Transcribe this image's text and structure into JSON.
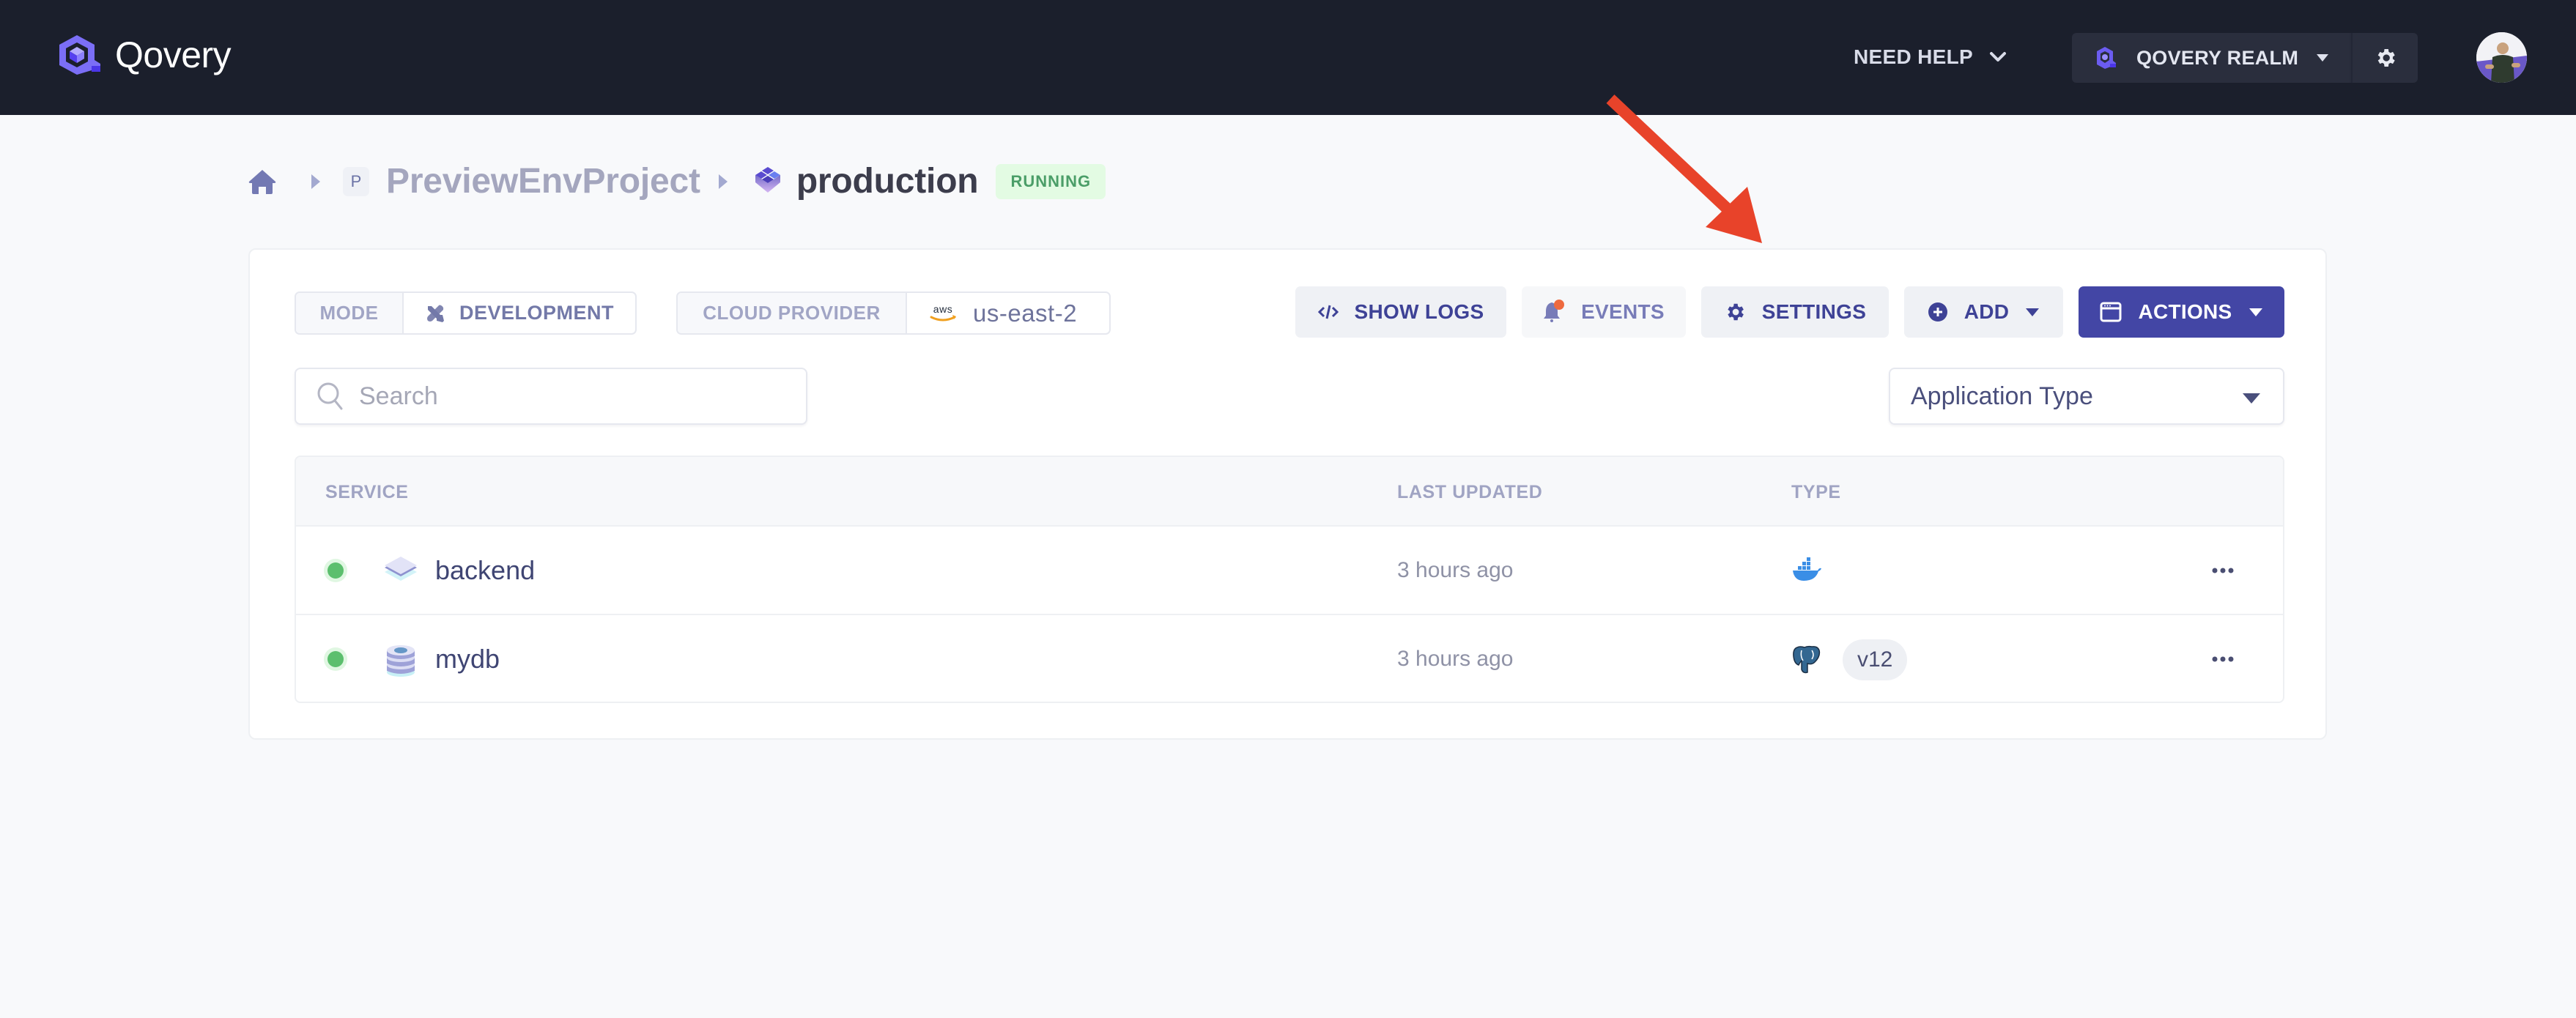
{
  "topbar": {
    "brand": "Qovery",
    "help_label": "NEED HELP",
    "org_label": "QOVERY REALM",
    "colors": {
      "background": "#1b1f2c",
      "brand": "#6f5cf6"
    }
  },
  "annotation": {
    "type": "arrow",
    "color": "#e8432a",
    "points_to": "settings-button"
  },
  "breadcrumb": {
    "project_initial": "P",
    "project": "PreviewEnvProject",
    "environment": "production",
    "status": "RUNNING"
  },
  "environment": {
    "mode_label": "MODE",
    "mode_value": "DEVELOPMENT",
    "cloud_label": "CLOUD PROVIDER",
    "cloud_provider_icon": "aws-icon",
    "cloud_region": "us-east-2"
  },
  "toolbar": {
    "show_logs": "SHOW LOGS",
    "events": "EVENTS",
    "settings": "SETTINGS",
    "add": "ADD",
    "actions": "ACTIONS"
  },
  "filters": {
    "search_placeholder": "Search",
    "search_value": "",
    "type_select": "Application Type"
  },
  "table": {
    "columns": [
      "SERVICE",
      "LAST UPDATED",
      "TYPE"
    ],
    "rows": [
      {
        "status": "running",
        "icon": "application-icon",
        "name": "backend",
        "last_updated": "3 hours ago",
        "type_icon": "docker-icon",
        "version": ""
      },
      {
        "status": "running",
        "icon": "database-icon",
        "name": "mydb",
        "last_updated": "3 hours ago",
        "type_icon": "postgresql-icon",
        "version": "v12"
      }
    ]
  },
  "colors": {
    "primary": "#4346a5",
    "status_running": "#5cbf6e",
    "badge_running_bg": "#e3fbe3",
    "badge_running_text": "#4b9e68"
  }
}
